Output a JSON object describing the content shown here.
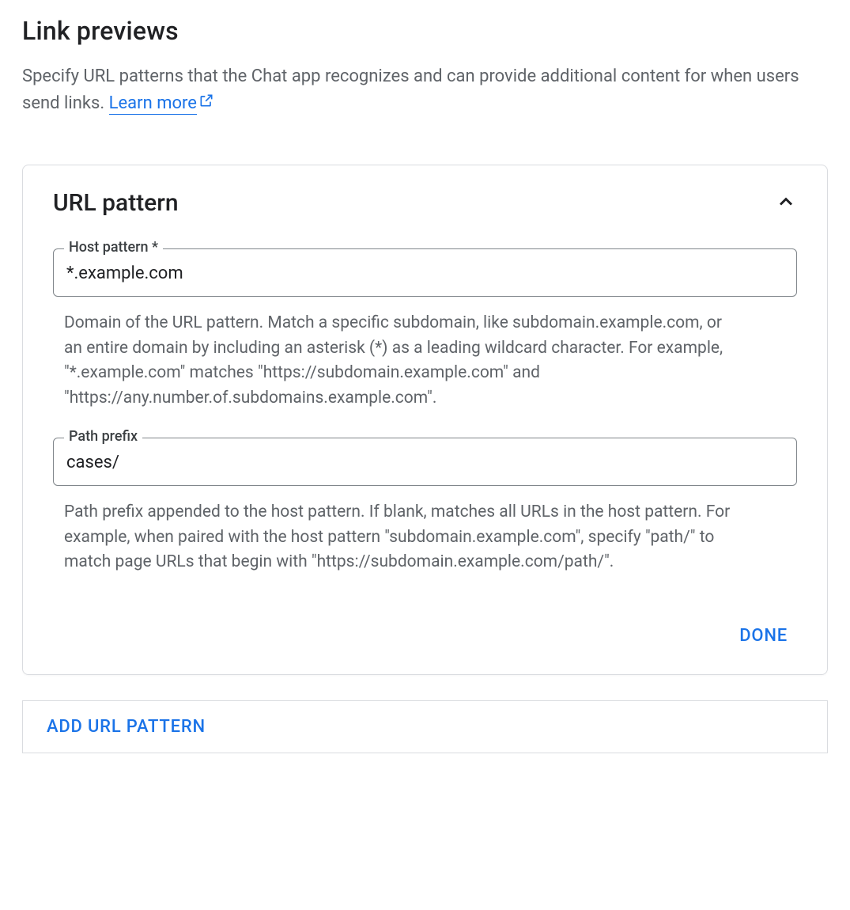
{
  "header": {
    "title": "Link previews",
    "description": "Specify URL patterns that the Chat app recognizes and can provide additional content for when users send links.",
    "learn_more": "Learn more"
  },
  "card": {
    "title": "URL pattern",
    "host_pattern": {
      "label": "Host pattern *",
      "value": "*.example.com",
      "helper": "Domain of the URL pattern. Match a specific subdomain, like subdomain.example.com, or an entire domain by including an asterisk (*) as a leading wildcard character. For example, \"*.example.com\" matches \"https://subdomain.example.com\" and \"https://any.number.of.subdomains.example.com\"."
    },
    "path_prefix": {
      "label": "Path prefix",
      "value": "cases/",
      "helper": "Path prefix appended to the host pattern. If blank, matches all URLs in the host pattern. For example, when paired with the host pattern \"subdomain.example.com\", specify \"path/\" to match page URLs that begin with \"https://subdomain.example.com/path/\"."
    },
    "done": "DONE"
  },
  "add_button": "ADD URL PATTERN"
}
